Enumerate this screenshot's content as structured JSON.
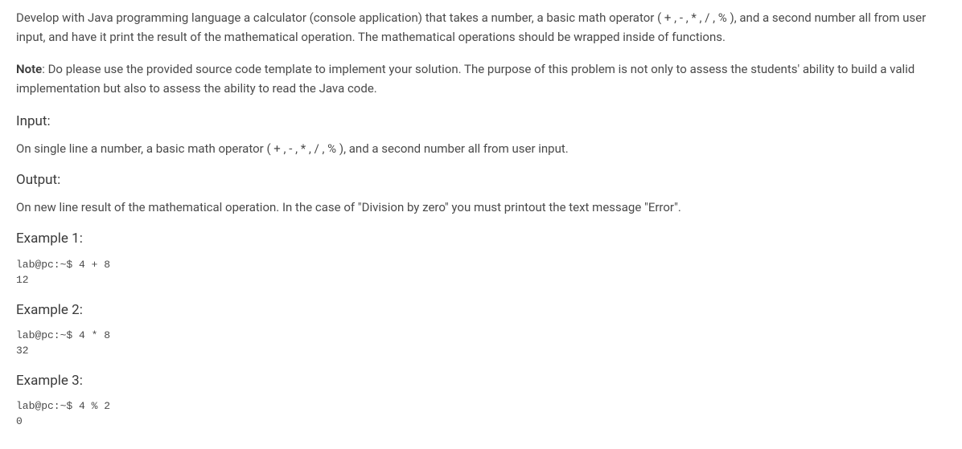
{
  "intro": {
    "paragraph1": "Develop with Java programming language a calculator (console application) that takes a number, a basic math operator ( + , - , * , / , % ), and a second number all from user input, and have it print the result of the mathematical operation. The mathematical operations should be wrapped inside of functions.",
    "note_label": "Note",
    "note_text": ": Do please use the provided source code template to implement your solution. The purpose of this problem is not only to assess the students' ability to build a valid implementation but also to assess the ability to read the Java code."
  },
  "input_section": {
    "heading": "Input:",
    "description": "On single line a number, a basic math operator ( + , - , * , / , % ), and a second number all from user input."
  },
  "output_section": {
    "heading": "Output:",
    "description": "On new line result of the mathematical operation. In the case of \"Division by zero\" you must printout the text message \"Error\"."
  },
  "example1": {
    "heading": "Example 1:",
    "code": "lab@pc:~$ 4 + 8\n12"
  },
  "example2": {
    "heading": "Example 2:",
    "code": "lab@pc:~$ 4 * 8\n32"
  },
  "example3": {
    "heading": "Example 3:",
    "code": "lab@pc:~$ 4 % 2\n0"
  }
}
